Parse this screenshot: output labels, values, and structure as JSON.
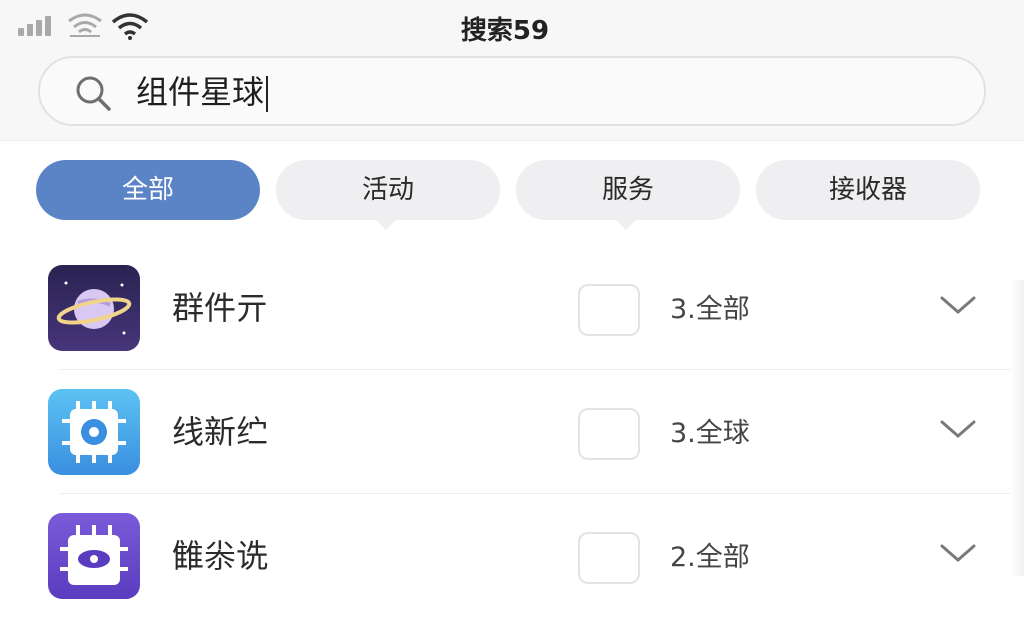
{
  "status_bar": {
    "title": "搜索59"
  },
  "search": {
    "value": "组件星球"
  },
  "tabs": [
    {
      "label": "全部",
      "active": true
    },
    {
      "label": "活动",
      "active": false
    },
    {
      "label": "服务",
      "active": false
    },
    {
      "label": "接收器",
      "active": false
    }
  ],
  "list": {
    "items": [
      {
        "name": "群件亓",
        "value": "3.全部",
        "icon": "planet-icon",
        "checked": false
      },
      {
        "name": "线新纻",
        "value": "3.全球",
        "icon": "chip-gear-icon",
        "checked": false
      },
      {
        "name": "雔尜诜",
        "value": "2.全部",
        "icon": "chip-eye-icon",
        "checked": false
      }
    ]
  },
  "colors": {
    "accent": "#5b84c7",
    "tab_bg": "#efeff1",
    "background": "#f7f7f8"
  }
}
